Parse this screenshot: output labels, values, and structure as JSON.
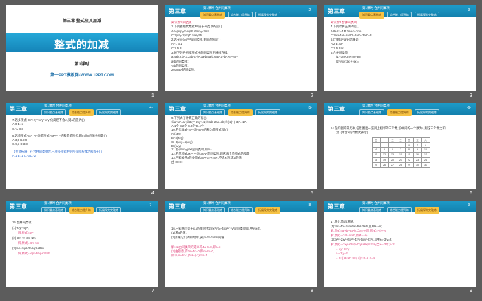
{
  "header": {
    "chapter": "第三章",
    "section": "第1课时 合并同类项",
    "tabs": [
      "知识要点基础练",
      "综合能力提升练",
      "拓展探究突破练"
    ]
  },
  "slides": [
    {
      "num": "1",
      "chapter": "第三章  整式及其加减",
      "title": "整式的加减",
      "lesson": "第1课时",
      "brand": "第一PPT模板网-WWW.1PPT.COM"
    },
    {
      "num": "2",
      "page": "-2-",
      "lines": [
        "知识点1  同类项",
        "1.下列各组代数式中,属于同类项的是(    )",
        "A.½p²q与½pq²        B.6m²与-2m³",
        "C.3p³与-2p³q        D.5a与5b",
        "2.若-x²yⁿ与x³y³是同类项,则m的值是(    )",
        "A.-1      B.1",
        "C.2       D.3",
        "3.将下列各组多项式中的同类项用横线连接:",
        "a,4ab,2,b³,3,2ab²c,-b²,3a²b,5a²b,6ab²,a³,b²,⅔,-⅓b³",
        "a²b的同类项:",
        "-ab的同类项:",
        "2018ab²的同类项:"
      ]
    },
    {
      "num": "3",
      "page": "-3-",
      "lines": [
        "知识点2  合并同类项",
        "4.下列计算正确的是(    )",
        "A.8+5x=4          B.2m+n=2mn",
        "C.2a²+4a²=6a²     D.-2a²b+3a²b=3",
        "5.计算3a²-a²的结果是(    )",
        "A.2          B.2a²",
        "C.3          D.3a²",
        "6.合并同类项:",
        "(1)-3m+3n+4m-3n=",
        "(2)⅓x-(-2x)+⅓x ="
      ]
    },
    {
      "num": "4",
      "page": "-4-",
      "lines": [
        "7.若多项式-3x²+2y³+x³y²-x²y³化简后不含x³,则a的值为(    )",
        "A.0          B.⅔",
        "C.⅓          D.3",
        "8.若单项式-3xᵐ⁻¹y³与单项式-⅓x²yⁿ⁻¹的和是单项式,则m与n的值分别是(   )",
        "A.3,9      B.9,9",
        "C.9,3      D.3,3",
        "【变式拓展】在合并同类项时,一项多项式中的所有项系数之和等于(    )",
        "A.1          B.-1          C.-3          D.-2"
      ]
    },
    {
      "num": "5",
      "page": "-5-",
      "lines": [
        "9.下列式子计算正确的有(    )",
        "①a²+a²=a⁴;②3xy²-2xy²=1;③3ab-2ab=ab;④(-2)³-(-3)²=-17.",
        "A.1个   B.2个   C.3个   D.4个",
        "10.若代数式-2x²y与-ax⁴y的和为单项式,则(    )",
        "A.(x≠y)",
        "B.-3(x≠y)",
        "C.-3(x≠y=6(x≠y)",
        "D.(x≠y)",
        "11.若-y²x²与y³x²是同类项,则m=      .",
        "12.若单项式2x²ᵃ⁺¹y与-3x³yᵇ是同类项,则这两个单项式的和是      .",
        "13.已知关于x的多项式ax²+bx²+2x+1不含x³项,求a的值.",
        "由 m=n="
      ]
    },
    {
      "num": "6",
      "page": "-6-",
      "lines": [
        "14.在如图的日历中,任意圈出一竖列上相邻的三个数,设中间的一个数为a,则这三个数之和",
        "为    .(用含a的代数式表示)"
      ],
      "table": [
        [
          "日",
          "一",
          "二",
          "三",
          "四",
          "五",
          "六"
        ],
        [
          "",
          "",
          "",
          "",
          "1",
          "2",
          "3"
        ],
        [
          "4",
          "5",
          "6",
          "7",
          "8",
          "9",
          "10"
        ],
        [
          "11",
          "12",
          "13",
          "14",
          "15",
          "16",
          "17"
        ],
        [
          "18",
          "19",
          "20",
          "21",
          "22",
          "23",
          "24"
        ],
        [
          "25",
          "26",
          "27",
          "28",
          "29",
          "30",
          "31"
        ]
      ]
    },
    {
      "num": "7",
      "page": "-7-",
      "lines": [
        "15.合并同类项:",
        "(1)-x-y²+5y²;",
        "解:原式=4y²",
        "(2)-3m-7n-3m+2n;",
        "解:原式=-6m-5n",
        "(3)⅓p+½p²-3p-⅓p²+8ab.",
        "解:原式=⅙p²-3⅔p+13ab"
      ]
    },
    {
      "num": "8",
      "page": "-8-",
      "lines": [
        "16.已知两个关于x,y的单项式2mx³y³与-4nx³ⁿ⁻⁴y³是同类项(其中xy≠0).",
        "(1)求a的值;",
        "(2)如果它们的和为零,求(m-2n-1)²⁰¹⁸的值.",
        "解:(1)由同类项的定义得4a-4=8,即a=3",
        "(2)由题意,得2m-4n=0,即m-2n=0,",
        "所以(m-2n-1)²⁰¹⁸=(-1)²⁰¹⁸=1."
      ]
    },
    {
      "num": "9",
      "page": "-9-",
      "lines": [
        "17.先化简,再求值:",
        "(1)3a²+4b²-2a²+6a²-3b²-3a²b,其中a=-⅓;",
        "解:原式=a²+b²-3a²b,当a=-⅓时,原式=-½+⅓",
        "解:原式=-2a³+a²+b,原式=-⅙",
        "(2)3x²y-2xy²+4x²y-4x²y-5xy²-2x²y,其中x=-3,y=2.",
        "解:原式=-3xy²+3x²y-7xy²+6xy²-2x²y,当x=-3时,y=2,",
        "=-xy²-2x²y",
        "x=-3,y=2",
        "=-2×(-3)×2²+3×(-3)²×2=3-2=4"
      ]
    }
  ]
}
